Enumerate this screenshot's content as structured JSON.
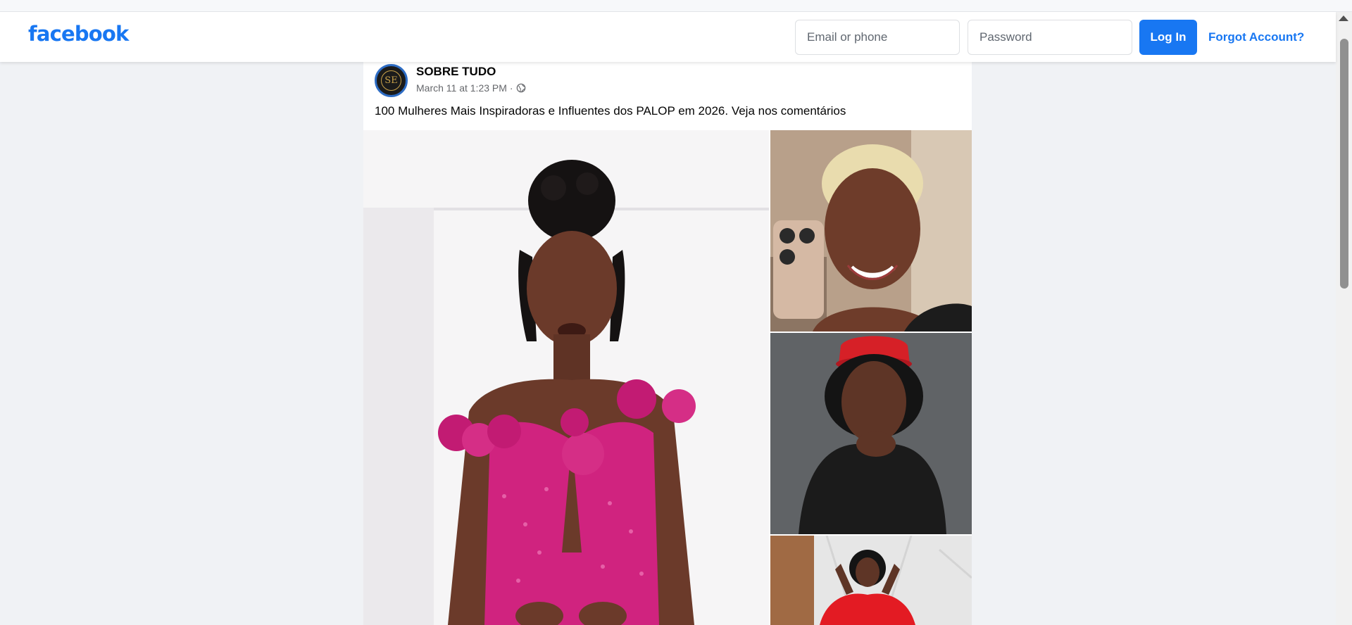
{
  "header": {
    "logo": "facebook",
    "email_placeholder": "Email or phone",
    "password_placeholder": "Password",
    "login_label": "Log In",
    "forgot_label": "Forgot Account?"
  },
  "post": {
    "avatar_initials": "SE",
    "page_name": "SOBRE TUDO",
    "timestamp": "March 11 at 1:23 PM",
    "separator": "·",
    "privacy_icon": "globe-icon",
    "text": "100 Mulheres Mais Inspiradoras e Influentes dos PALOP em 2026. Veja nos comentários",
    "photos": [
      {
        "id": "photo-pink-dress"
      },
      {
        "id": "photo-blonde-selfie"
      },
      {
        "id": "photo-red-hat"
      },
      {
        "id": "photo-red-dress"
      }
    ]
  },
  "colors": {
    "brand": "#1877f2",
    "background": "#f0f2f5",
    "dress_pink": "#d0237f",
    "hat_red": "#d62027"
  }
}
